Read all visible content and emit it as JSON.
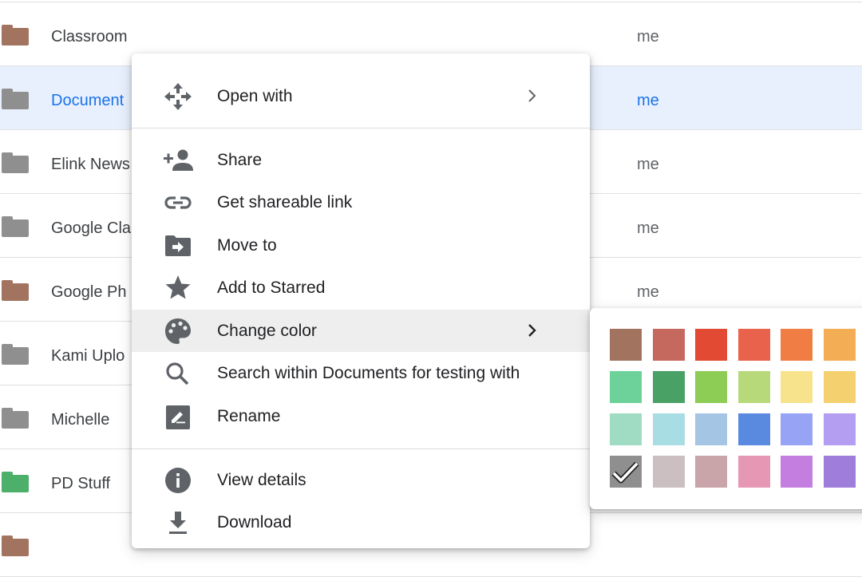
{
  "files": [
    {
      "name": "Classroom",
      "owner": "me",
      "folder_color": "#a2735f",
      "selected": false
    },
    {
      "name": "Document",
      "owner": "me",
      "folder_color": "#8f8f8f",
      "selected": true
    },
    {
      "name": "Elink News",
      "owner": "me",
      "folder_color": "#8f8f8f",
      "selected": false
    },
    {
      "name": "Google Cla",
      "owner": "me",
      "folder_color": "#8f8f8f",
      "selected": false
    },
    {
      "name": "Google Ph",
      "owner": "me",
      "folder_color": "#a2735f",
      "selected": false
    },
    {
      "name": "Kami Uplo",
      "owner": "",
      "folder_color": "#8f8f8f",
      "selected": false
    },
    {
      "name": "Michelle",
      "owner": "",
      "folder_color": "#8f8f8f",
      "selected": false
    },
    {
      "name": "PD Stuff",
      "owner": "",
      "folder_color": "#4caf6a",
      "selected": false
    },
    {
      "name": "",
      "owner": "",
      "folder_color": "#a2735f",
      "selected": false
    }
  ],
  "context_menu": {
    "open_with": {
      "label": "Open with",
      "icon": "move-arrows-icon"
    },
    "share": {
      "label": "Share",
      "icon": "person-add-icon"
    },
    "get_link": {
      "label": "Get shareable link",
      "icon": "link-icon"
    },
    "move_to": {
      "label": "Move to",
      "icon": "folder-move-icon"
    },
    "add_starred": {
      "label": "Add to Starred",
      "icon": "star-icon"
    },
    "change_color": {
      "label": "Change color",
      "icon": "palette-icon"
    },
    "search_within": {
      "label": "Search within Documents for testing with",
      "icon": "search-icon"
    },
    "rename": {
      "label": "Rename",
      "icon": "edit-icon"
    },
    "view_details": {
      "label": "View details",
      "icon": "info-icon"
    },
    "download": {
      "label": "Download",
      "icon": "download-icon"
    }
  },
  "palette": {
    "selected_index": 18,
    "colors": [
      "#a2735f",
      "#c5695f",
      "#e24a33",
      "#e9624b",
      "#f07e44",
      "#f3ad54",
      "#6cd29a",
      "#4aa165",
      "#8dcd55",
      "#b8d97a",
      "#f8e38d",
      "#f4d06f",
      "#9fdcc3",
      "#a9dde4",
      "#a5c5e5",
      "#5a8ae0",
      "#97a3f5",
      "#b39ef2",
      "#8f8f8f",
      "#cbbfc1",
      "#c9a5aa",
      "#e697b4",
      "#c47ee0",
      "#9f7edb"
    ]
  },
  "colors": {
    "selected_row_bg": "#e8f0fe",
    "selected_text": "#1a73e8",
    "hover_bg": "#eeeeee",
    "icon_gray": "#5f6368"
  }
}
